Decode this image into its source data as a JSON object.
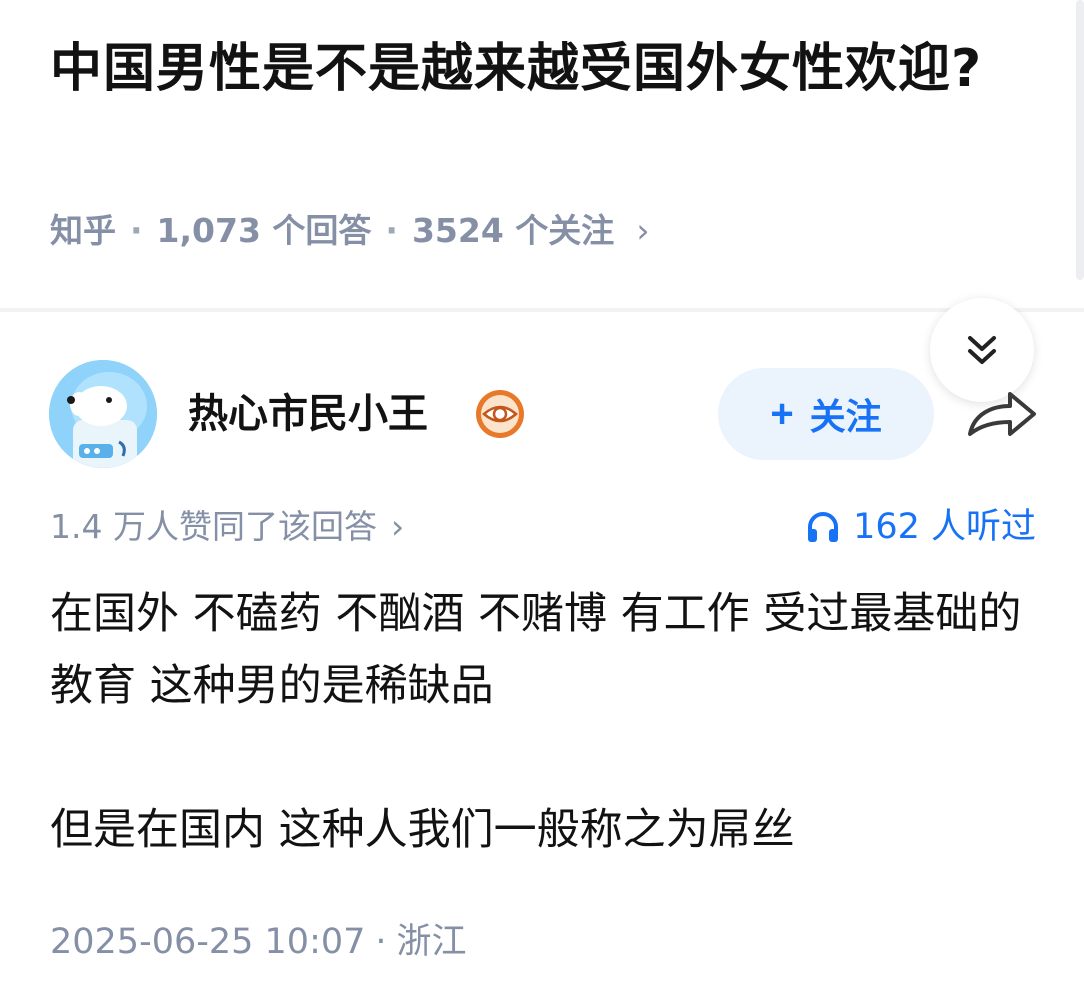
{
  "question": {
    "title": "中国男性是不是越来越受国外女性欢迎?",
    "source": "知乎",
    "answer_count": "1,073 个回答",
    "follower_count": "3524 个关注",
    "chevron": "›"
  },
  "author": {
    "name": "热心市民小王",
    "follow_plus": "+",
    "follow_label": "关注",
    "badge_icon": "eye-badge-icon",
    "avatar_icon": "astronaut-dog-avatar"
  },
  "stats": {
    "upvotes": "1.4 万人赞同了该回答",
    "chevron": "›",
    "listens": "162 人听过"
  },
  "answer": {
    "paragraph1": "在国外 不磕药 不酗酒 不赌博 有工作 受过最基础的教育 这种男的是稀缺品",
    "paragraph2": "但是在国内 这种人我们一般称之为屌丝"
  },
  "meta": {
    "date": "2025-06-25 10:07",
    "dot": "·",
    "location": "浙江"
  },
  "colors": {
    "accent": "#1772f6",
    "follow_bg": "#ebf3fd",
    "meta_gray": "#8590a6",
    "text": "#121212",
    "badge_orange": "#e8782a"
  }
}
